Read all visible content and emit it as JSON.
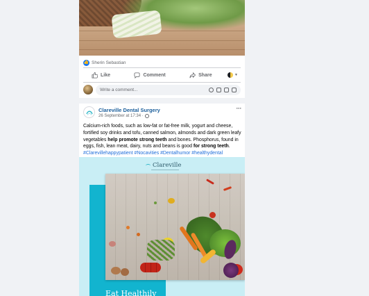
{
  "feed": {
    "post1": {
      "reactor_name": "Sherin Sebastian",
      "like_label": "Like",
      "comment_label": "Comment",
      "share_label": "Share",
      "comment_placeholder": "Write a comment..."
    },
    "post2": {
      "page_name": "Clareville Dental Surgery",
      "timestamp": "26 September at 17:34 ·",
      "more_label": "···",
      "body_part1": "Calcium-rich foods, such as low-fat or fat-free milk, yogurt and cheese, fortified soy drinks and tofu, canned salmon, almonds and dark green leafy vegetables ",
      "body_bold1": "help promote strong teeth",
      "body_part2": " and bones. Phosphorus, found in eggs, fish, lean meat, dairy, nuts and beans is good ",
      "body_bold2": "for strong teeth",
      "body_part3": ".",
      "hashtags": "#Clarevillehappypatient #Nocavities #Dentalhumor #healthydental",
      "promo": {
        "logo_text": "Clareville",
        "headline": "Eat Healthily"
      }
    }
  },
  "colors": {
    "facebook_blue": "#1877f2",
    "page_name": "#1b5e9b",
    "hashtag": "#216fdb",
    "promo_bg": "#c9eef5",
    "promo_teal": "#12b4cf"
  }
}
